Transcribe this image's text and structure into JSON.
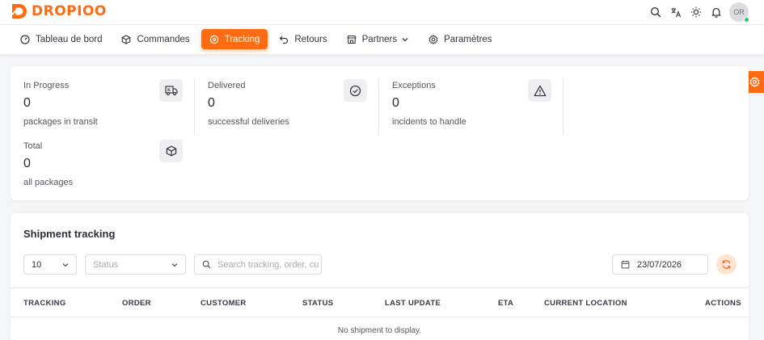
{
  "brand": {
    "name": "DROPIOO",
    "color": "#ff6b12"
  },
  "topbar": {
    "icons": [
      "search-icon",
      "translate-icon",
      "sun-icon",
      "bell-icon"
    ],
    "avatar_initials": "OR"
  },
  "nav": {
    "items": [
      {
        "label": "Tableau de bord",
        "icon": "dashboard-icon"
      },
      {
        "label": "Commandes",
        "icon": "box-icon"
      },
      {
        "label": "Tracking",
        "icon": "location-icon",
        "active": true
      },
      {
        "label": "Retours",
        "icon": "return-icon"
      },
      {
        "label": "Partners",
        "icon": "store-icon"
      },
      {
        "label": "Paramètres",
        "icon": "gear-icon"
      }
    ]
  },
  "stats": [
    {
      "label": "In Progress",
      "value": "0",
      "desc": "packages in transit",
      "icon": "truck-icon"
    },
    {
      "label": "Delivered",
      "value": "0",
      "desc": "successful deliveries",
      "icon": "check-circle-icon"
    },
    {
      "label": "Exceptions",
      "value": "0",
      "desc": "incidents to handle",
      "icon": "alert-icon"
    },
    {
      "label": "Total",
      "value": "0",
      "desc": "all packages",
      "icon": "package-icon"
    }
  ],
  "shipment": {
    "title": "Shipment tracking",
    "page_size": "10",
    "status_placeholder": "Status",
    "search_placeholder": "Search tracking, order, cu",
    "date": "23/07/2026",
    "columns": [
      "TRACKING",
      "ORDER",
      "CUSTOMER",
      "STATUS",
      "LAST UPDATE",
      "ETA",
      "CURRENT LOCATION",
      "ACTIONS"
    ],
    "empty_message": "No shipment to display."
  }
}
